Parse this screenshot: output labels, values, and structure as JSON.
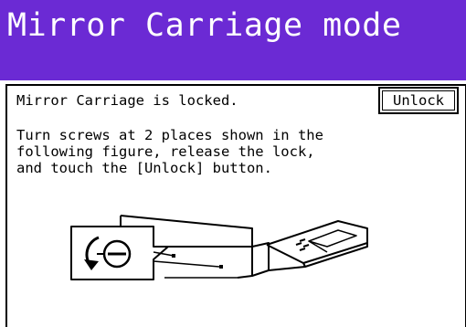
{
  "title_bar": {
    "title": "Mirror Carriage mode",
    "background_color": "#6b2ad4",
    "text_color": "#ffffff"
  },
  "status": {
    "message": "Mirror Carriage is locked."
  },
  "unlock_button": {
    "label": "Unlock"
  },
  "instructions": {
    "lines": [
      "Turn screws at 2 places shown in the",
      "following figure, release the lock,",
      "and touch the [Unlock] button."
    ]
  },
  "figure": {
    "icons": [
      "screw-rotate-icon",
      "scanner-illustration"
    ]
  }
}
